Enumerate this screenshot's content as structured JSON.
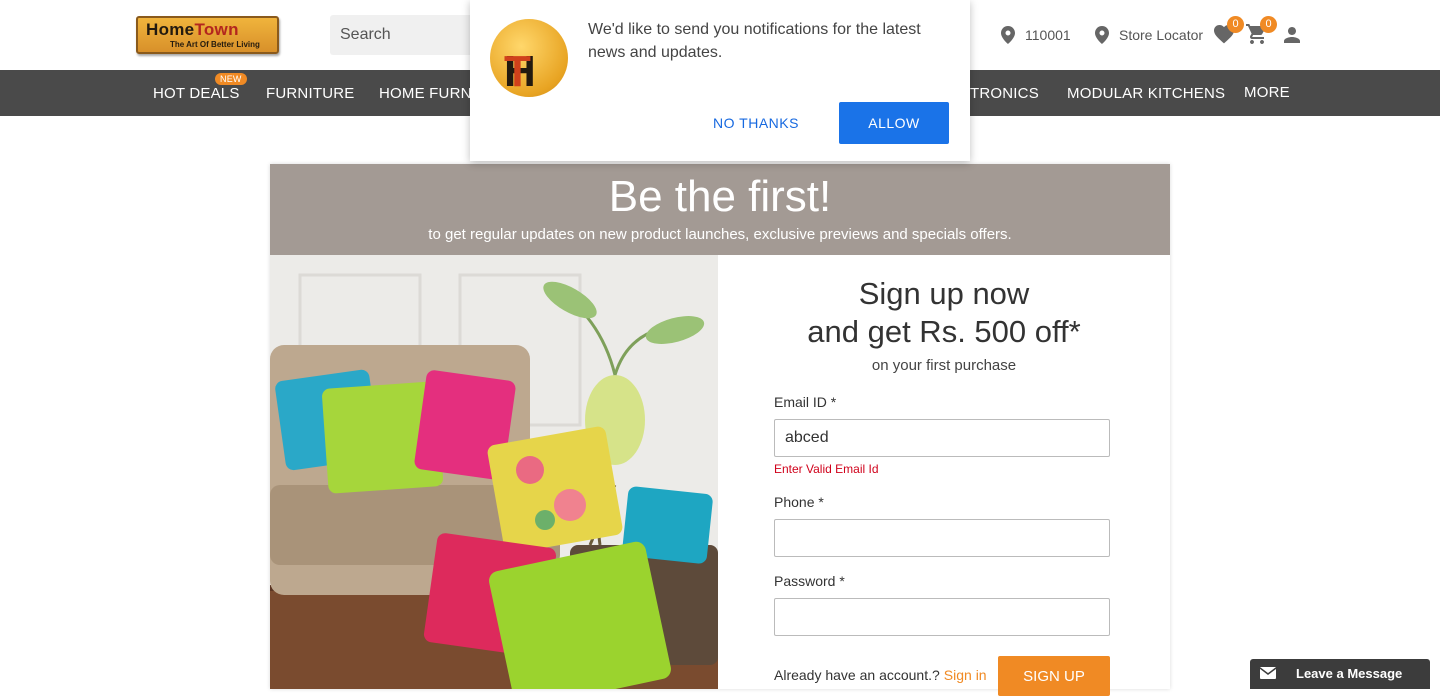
{
  "header": {
    "logo_line1_a": "Home",
    "logo_line1_b": "Town",
    "logo_line2": "The Art Of Better Living",
    "search_placeholder": "Search",
    "pincode": "110001",
    "store_locator": "Store Locator",
    "wishlist_count": "0",
    "cart_count": "0"
  },
  "nav": {
    "items": [
      "HOT DEALS",
      "FURNITURE",
      "HOME FURNIS",
      "TRONICS",
      "MODULAR KITCHENS",
      "MORE"
    ],
    "new_badge": "NEW"
  },
  "notification": {
    "logo_h": "H",
    "logo_t": "T",
    "message": "We'd like to send you notifications for the latest news and updates.",
    "no_thanks": "NO THANKS",
    "allow": "ALLOW"
  },
  "banner": {
    "title": "Be the first!",
    "subtitle": "to get regular updates on new product launches, exclusive previews and specials offers."
  },
  "signup": {
    "heading_line1": "Sign up now",
    "heading_line2": "and get Rs. 500 off*",
    "sub": "on your first purchase",
    "email_label": "Email ID *",
    "email_value": "abced",
    "email_error": "Enter Valid Email Id",
    "phone_label": "Phone *",
    "phone_value": "",
    "password_label": "Password *",
    "password_value": "",
    "already_text": "Already have an account.?",
    "signin_link": "Sign in",
    "signup_button": "SIGN UP"
  },
  "chat": {
    "label": "Leave a Message"
  },
  "colors": {
    "accent_orange": "#f08a24",
    "nav_bg": "#4a4a4a",
    "banner_bg": "#a39a94",
    "allow_blue": "#1a73e8",
    "error_red": "#d0021b"
  }
}
